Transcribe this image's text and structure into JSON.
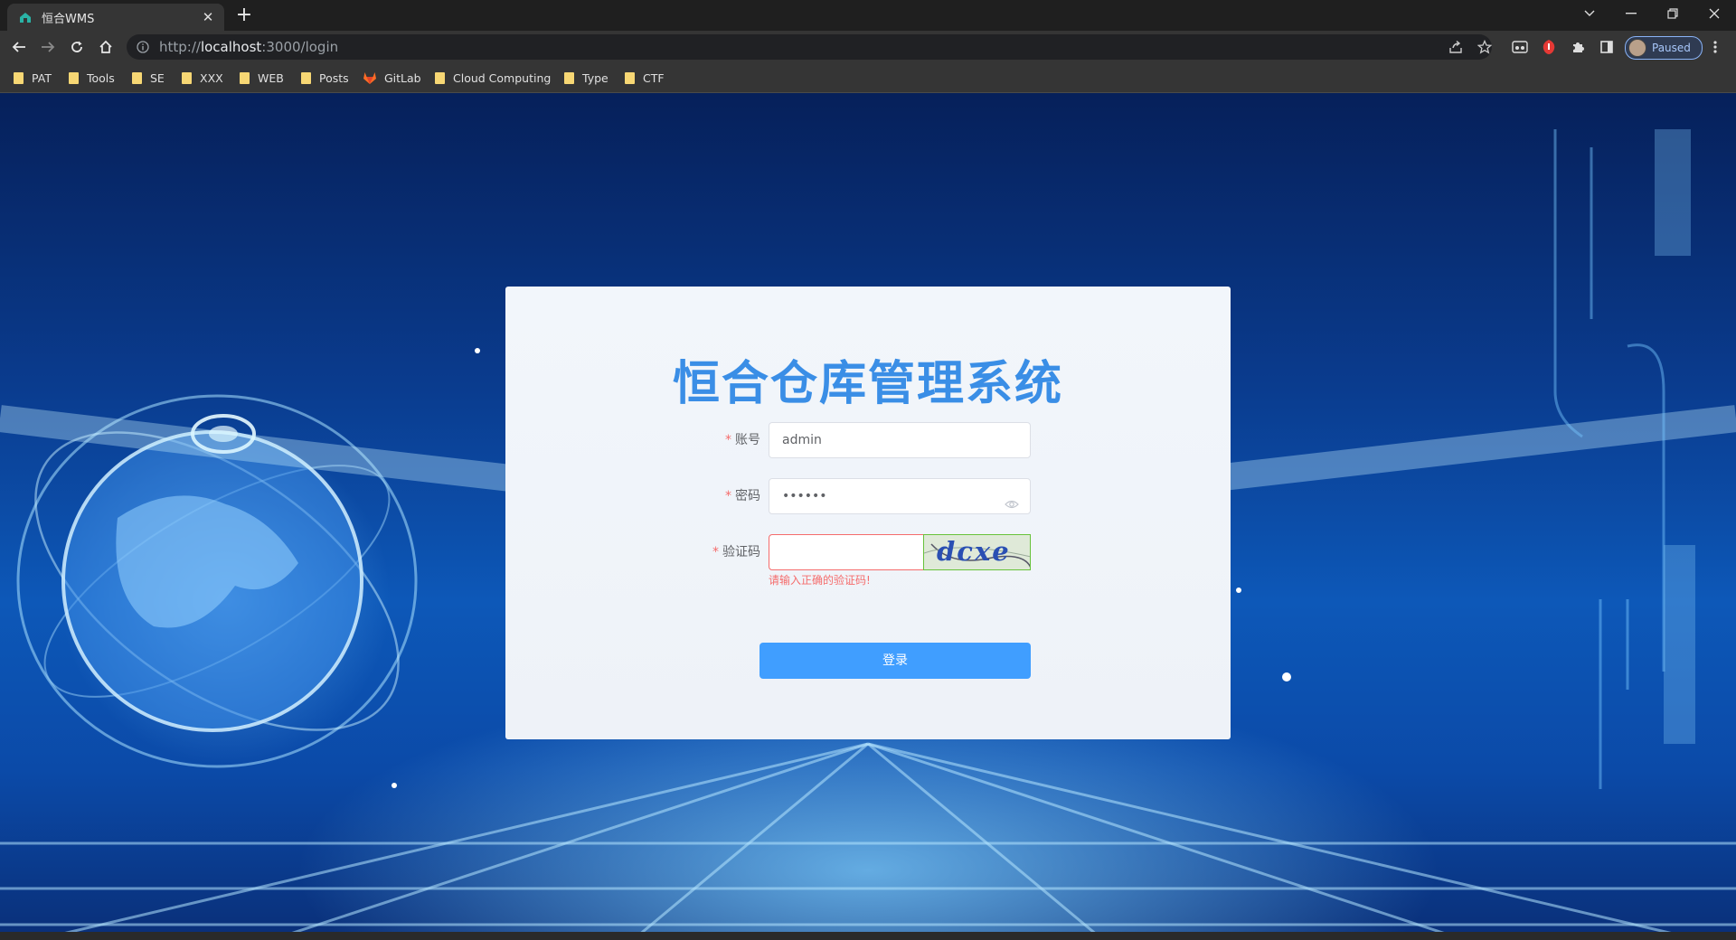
{
  "browser": {
    "tab_title": "恒合WMS",
    "url_scheme": "http://",
    "url_host": "localhost",
    "url_rest": ":3000/login",
    "profile_label": "Paused",
    "bookmarks": [
      "PAT",
      "Tools",
      "SE",
      "XXX",
      "WEB",
      "Posts",
      "GitLab",
      "Cloud Computing",
      "Type",
      "CTF"
    ]
  },
  "login": {
    "title": "恒合仓库管理系统",
    "account_label": "账号",
    "account_value": "admin",
    "password_label": "密码",
    "password_value": "••••••",
    "captcha_label": "验证码",
    "captcha_value": "",
    "captcha_image_text": "dcxe",
    "captcha_error": "请输入正确的验证码!",
    "required_mark": "*",
    "login_button": "登录"
  },
  "colors": {
    "primary": "#409eff",
    "title": "#3a8ee6",
    "error": "#f56c6c",
    "captcha_border": "#67c23a"
  }
}
